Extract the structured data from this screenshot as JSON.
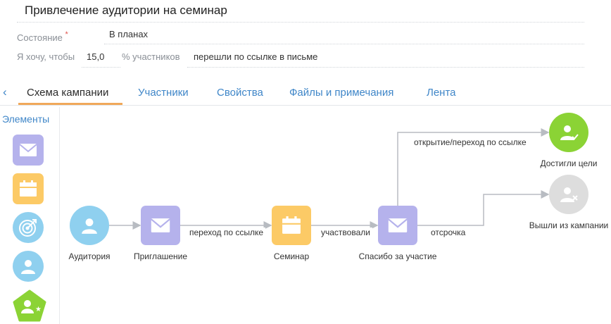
{
  "header": {
    "title": "Привлечение аудитории на семинар",
    "state_label": "Состояние",
    "state_required_mark": "*",
    "state_value": "В планах",
    "goal_label": "Я хочу, чтобы",
    "goal_number": "15,0",
    "goal_unit_label": "% участников",
    "goal_action": "перешли по ссылке в письме"
  },
  "tabs": [
    {
      "label": "Схема кампании",
      "active": true
    },
    {
      "label": "Участники"
    },
    {
      "label": "Свойства"
    },
    {
      "label": "Файлы и примечания"
    },
    {
      "label": "Лента"
    }
  ],
  "nav": {
    "back_icon": "chevron-left-icon"
  },
  "palette": {
    "title": "Элементы",
    "items": [
      {
        "icon": "email-icon",
        "color": "#b5b2ec"
      },
      {
        "icon": "calendar-icon",
        "color": "#fcca66"
      },
      {
        "icon": "target-icon",
        "color": "#8fd0ef"
      },
      {
        "icon": "user-icon",
        "color": "#8fd0ef"
      },
      {
        "icon": "user-star-icon",
        "color": "#8bd335"
      }
    ]
  },
  "diagram": {
    "nodes": [
      {
        "id": "audience",
        "label": "Аудитория",
        "icon": "user-icon",
        "color": "#8fd0ef"
      },
      {
        "id": "invite",
        "label": "Приглашение",
        "icon": "email-icon",
        "color": "#b5b2ec"
      },
      {
        "id": "seminar",
        "label": "Семинар",
        "icon": "calendar-icon",
        "color": "#fcca66"
      },
      {
        "id": "thanks",
        "label": "Спасибо за участие",
        "icon": "email-icon",
        "color": "#b5b2ec"
      },
      {
        "id": "goal",
        "label": "Достигли цели",
        "icon": "user-check-icon",
        "color": "#8bd335"
      },
      {
        "id": "exited",
        "label": "Вышли из кампании",
        "icon": "user-x-icon",
        "color": "#dddddd"
      }
    ],
    "edges": [
      {
        "from": "audience",
        "to": "invite",
        "label": ""
      },
      {
        "from": "invite",
        "to": "seminar",
        "label": "переход по ссылке"
      },
      {
        "from": "seminar",
        "to": "thanks",
        "label": "участвовали"
      },
      {
        "from": "thanks",
        "to": "goal",
        "label": "открытие/переход по ссылке"
      },
      {
        "from": "thanks",
        "to": "exited",
        "label": "отсрочка"
      }
    ],
    "line_color": "#b8bcc2"
  }
}
